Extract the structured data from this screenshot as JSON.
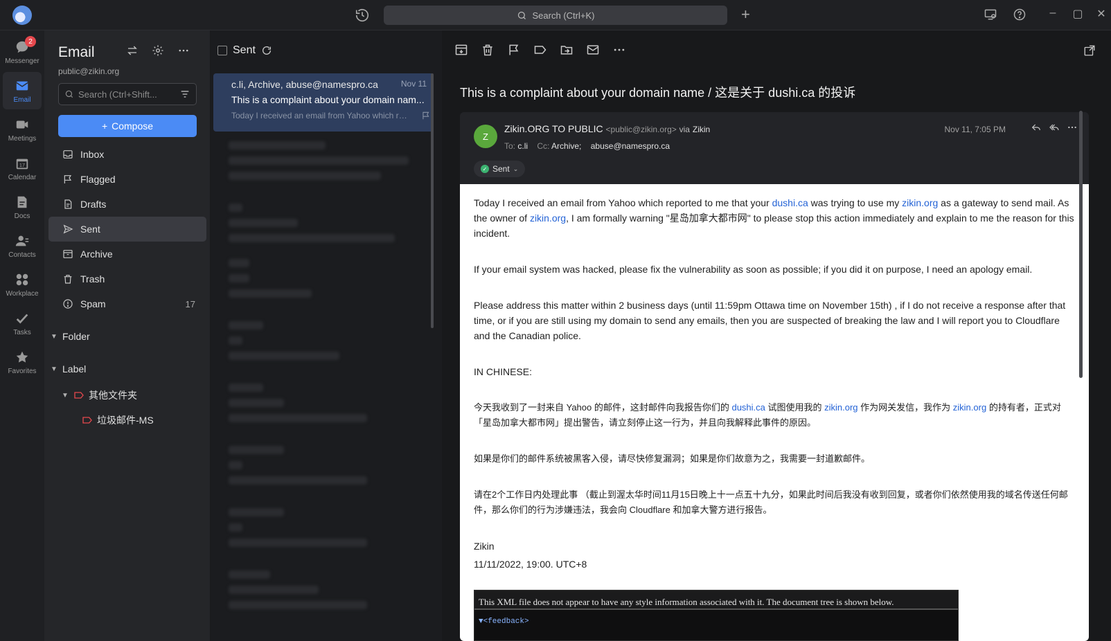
{
  "app": {
    "search_placeholder": "Search (Ctrl+K)"
  },
  "rail": {
    "items": [
      {
        "label": "Messenger",
        "badge": "2"
      },
      {
        "label": "Email"
      },
      {
        "label": "Meetings"
      },
      {
        "label": "Calendar"
      },
      {
        "label": "Docs"
      },
      {
        "label": "Contacts"
      },
      {
        "label": "Workplace"
      },
      {
        "label": "Tasks"
      },
      {
        "label": "Favorites"
      }
    ]
  },
  "nav": {
    "title": "Email",
    "account": "public@zikin.org",
    "search_placeholder": "Search (Ctrl+Shift...",
    "compose": "Compose",
    "folders": [
      {
        "label": "Inbox",
        "icon": "inbox-icon"
      },
      {
        "label": "Flagged",
        "icon": "flag-icon"
      },
      {
        "label": "Drafts",
        "icon": "drafts-icon"
      },
      {
        "label": "Sent",
        "icon": "send-icon"
      },
      {
        "label": "Archive",
        "icon": "archive-icon"
      },
      {
        "label": "Trash",
        "icon": "trash-icon"
      },
      {
        "label": "Spam",
        "icon": "spam-icon",
        "count": "17"
      }
    ],
    "folder_section": "Folder",
    "label_section": "Label",
    "labels": [
      {
        "label": "其他文件夹"
      },
      {
        "label": "垃圾邮件-MS"
      }
    ]
  },
  "list": {
    "title": "Sent",
    "selected": {
      "from": "c.li, Archive, abuse@namespro.ca",
      "date": "Nov 11",
      "subject": "This is a complaint about your domain nam...",
      "preview": "Today I received an email from Yahoo which re..."
    }
  },
  "reader": {
    "subject": "This is a complaint about your domain name / 这是关于 dushi.ca 的投诉",
    "avatar_letter": "Z",
    "sender_name": "Zikin.ORG TO PUBLIC",
    "sender_addr": "<public@zikin.org>",
    "via_label": "via",
    "via_name": "Zikin",
    "to_label": "To:",
    "to": "c.li",
    "cc_label": "Cc:",
    "cc1": "Archive;",
    "cc2": "abuse@namespro.ca",
    "date": "Nov 11, 7:05 PM",
    "status": "Sent",
    "body": {
      "p1a": "Today I received an email from Yahoo which reported to me that your ",
      "p1_link1": "dushi.ca",
      "p1b": "  was trying to use my ",
      "p1_link2": "zikin.org",
      "p1c": "  as a gateway to send mail. As the owner of ",
      "p1_link3": "zikin.org",
      "p1d": ", I am formally warning \"星岛加拿大都市网\" to please stop this action immediately and explain to me the reason for this incident.",
      "p2": "If your email system was hacked, please fix the vulnerability as soon as possible; if you did it on purpose, I need an apology email.",
      "p3": "Please address this matter within 2 business days (until 11:59pm Ottawa time on November 15th) , if I do not receive a response after that time, or if you are still using my domain to send any emails, then you are suspected of breaking the law and I will report you to Cloudflare and the Canadian police.",
      "p4": "IN CHINESE:",
      "p5a": "今天我收到了一封来自 Yahoo 的邮件，这封邮件向我报告你们的 ",
      "p5_link1": "dushi.ca",
      "p5b": " 试图使用我的 ",
      "p5_link2": "zikin.org",
      "p5c": " 作为网关发信，我作为 ",
      "p5_link3": "zikin.org",
      "p5d": " 的持有者，正式对「星岛加拿大都市网」提出警告，请立刻停止这一行为，并且向我解释此事件的原因。",
      "p6": "如果是你们的邮件系统被黑客入侵，请尽快修复漏洞；如果是你们故意为之，我需要一封道歉邮件。",
      "p7": "请在2个工作日内处理此事 （截止到渥太华时间11月15日晚上十一点五十九分，如果此时间后我没有收到回复，或者你们依然使用我的域名传送任何邮件，那么你们的行为涉嫌违法，我会向 Cloudflare 和加拿大警方进行报告。",
      "sig_name": "Zikin",
      "sig_date": "11/11/2022, 19:00. UTC+8",
      "xml_notice": "This XML file does not appear to have any style information associated with it. The document tree is shown below.",
      "xml_tag": "▼<feedback>"
    }
  }
}
